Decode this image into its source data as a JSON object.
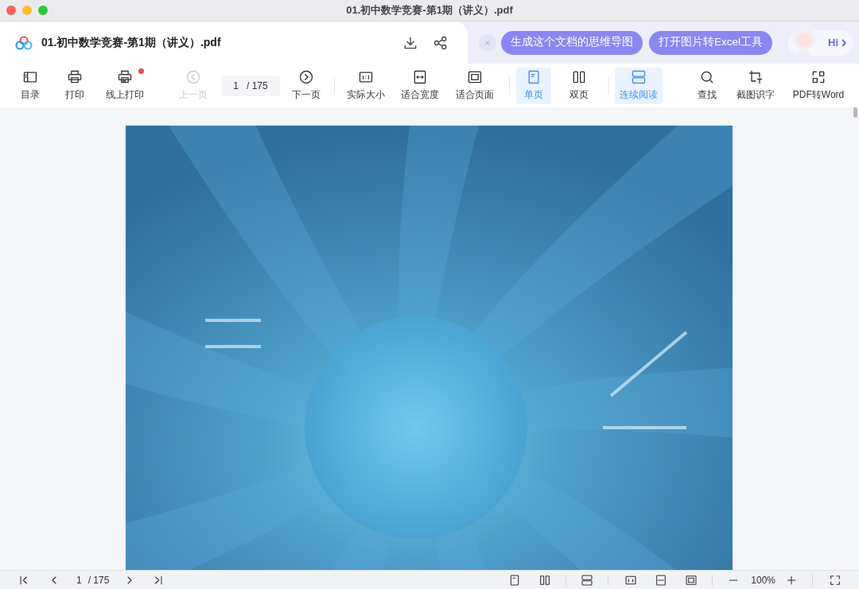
{
  "window": {
    "title": "01.初中数学竞赛-第1期（讲义）.pdf"
  },
  "header": {
    "file_name": "01.初中数学竞赛-第1期（讲义）.pdf",
    "suggestions": [
      "生成这个文档的思维导图",
      "打开图片转Excel工具"
    ],
    "assistant_label": "Hi"
  },
  "toolbar": [
    {
      "label": "目录",
      "disabled": false,
      "selected": false
    },
    {
      "label": "打印",
      "disabled": false,
      "selected": false
    },
    {
      "label": "线上打印",
      "disabled": false,
      "selected": false,
      "badge": true
    },
    {
      "label": "上一页",
      "disabled": true,
      "selected": false
    },
    {
      "label": "下一页",
      "disabled": false,
      "selected": false
    },
    {
      "label": "实际大小",
      "disabled": false,
      "selected": false
    },
    {
      "label": "适合宽度",
      "disabled": false,
      "selected": false
    },
    {
      "label": "适合页面",
      "disabled": false,
      "selected": false
    },
    {
      "label": "单页",
      "disabled": false,
      "selected": true
    },
    {
      "label": "双页",
      "disabled": false,
      "selected": false
    },
    {
      "label": "连续阅读",
      "disabled": false,
      "selected": true
    },
    {
      "label": "查找",
      "disabled": false,
      "selected": false
    },
    {
      "label": "截图识字",
      "disabled": false,
      "selected": false
    },
    {
      "label": "PDF转Word",
      "disabled": false,
      "selected": false
    }
  ],
  "page_field": {
    "value": "1",
    "total": "/ 175"
  },
  "status_bar": {
    "page_value": "1",
    "page_total": "/ 175",
    "zoom": "100%"
  }
}
